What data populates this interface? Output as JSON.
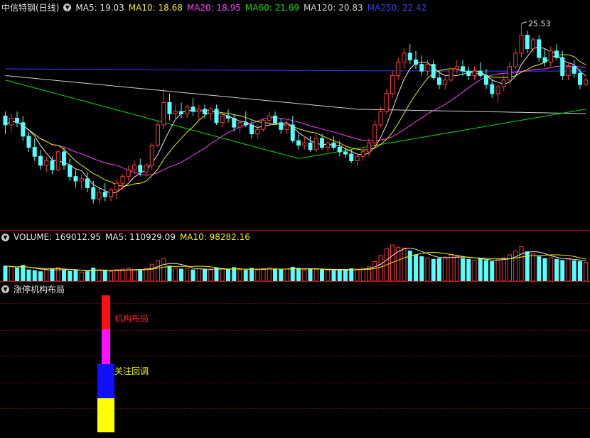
{
  "price_header": {
    "title": "中信特钢(日线)",
    "ma": [
      {
        "label": "MA5: 19.03",
        "color": "#e8e8e8"
      },
      {
        "label": "MA10: 18.68",
        "color": "#f0f000"
      },
      {
        "label": "MA20: 18.95",
        "color": "#ff40ff"
      },
      {
        "label": "MA60: 21.69",
        "color": "#00e000"
      },
      {
        "label": "MA120: 20.83",
        "color": "#d0d0d0"
      },
      {
        "label": "MA250: 22.42",
        "color": "#3c3cff"
      }
    ],
    "high_label": "25.53"
  },
  "volume_header": {
    "title": "VOLUME: 169012.95",
    "ma5": "MA5: 110929.09",
    "ma10": "MA10: 98282.16"
  },
  "indicator_header": {
    "title": "涨停机构布局"
  },
  "indicator_labels": {
    "top": "机构布局",
    "mid": "关注回调"
  },
  "icons": {
    "toggle": "chevron-down-icon"
  },
  "colors": {
    "up": "#ff3b3b",
    "down": "#54ffff",
    "ma5": "#e8e8e8",
    "ma10": "#f0f000",
    "ma20": "#ff40ff",
    "ma60": "#00e000",
    "ma120": "#d0d0d0",
    "ma250": "#3c3cff"
  },
  "chart_data": {
    "type": "candlestick",
    "ohlc": [
      [
        21.4,
        21.6,
        20.6,
        21.0
      ],
      [
        21.0,
        21.5,
        20.7,
        21.3
      ],
      [
        21.3,
        21.6,
        20.9,
        21.1
      ],
      [
        21.1,
        21.4,
        20.3,
        20.5
      ],
      [
        20.5,
        20.7,
        19.8,
        20.0
      ],
      [
        20.0,
        20.4,
        19.4,
        19.6
      ],
      [
        19.6,
        19.9,
        19.0,
        19.2
      ],
      [
        19.2,
        19.6,
        18.9,
        19.4
      ],
      [
        19.4,
        19.6,
        18.8,
        19.0
      ],
      [
        19.0,
        19.9,
        18.9,
        19.8
      ],
      [
        19.8,
        20.0,
        19.0,
        19.2
      ],
      [
        19.2,
        19.5,
        18.5,
        18.7
      ],
      [
        18.7,
        19.0,
        18.2,
        18.5
      ],
      [
        18.5,
        18.8,
        18.1,
        18.6
      ],
      [
        18.6,
        18.9,
        18.0,
        18.2
      ],
      [
        18.2,
        18.5,
        17.5,
        17.7
      ],
      [
        17.7,
        18.2,
        17.5,
        18.0
      ],
      [
        18.0,
        18.4,
        17.6,
        17.8
      ],
      [
        17.8,
        18.2,
        17.6,
        18.1
      ],
      [
        18.1,
        18.6,
        17.7,
        18.4
      ],
      [
        18.4,
        18.8,
        18.1,
        18.7
      ],
      [
        18.7,
        19.2,
        18.5,
        19.0
      ],
      [
        19.0,
        19.4,
        18.8,
        19.2
      ],
      [
        19.2,
        19.5,
        18.7,
        18.9
      ],
      [
        18.9,
        19.3,
        18.7,
        19.2
      ],
      [
        19.2,
        20.2,
        19.0,
        20.1
      ],
      [
        20.1,
        21.2,
        20.0,
        21.0
      ],
      [
        21.0,
        22.6,
        20.8,
        22.0
      ],
      [
        22.0,
        22.4,
        21.2,
        21.5
      ],
      [
        21.5,
        21.9,
        21.2,
        21.6
      ],
      [
        21.6,
        22.0,
        21.3,
        21.5
      ],
      [
        21.5,
        21.9,
        21.3,
        21.8
      ],
      [
        21.8,
        22.2,
        21.4,
        21.6
      ],
      [
        21.6,
        21.9,
        21.2,
        21.7
      ],
      [
        21.7,
        21.9,
        21.3,
        21.5
      ],
      [
        21.5,
        21.8,
        21.2,
        21.7
      ],
      [
        21.7,
        21.9,
        21.0,
        21.1
      ],
      [
        21.1,
        21.5,
        20.9,
        21.4
      ],
      [
        21.4,
        21.7,
        21.1,
        21.3
      ],
      [
        21.3,
        21.5,
        20.7,
        20.9
      ],
      [
        20.9,
        21.2,
        20.6,
        21.1
      ],
      [
        21.1,
        21.6,
        20.9,
        21.0
      ],
      [
        21.0,
        21.2,
        20.4,
        20.6
      ],
      [
        20.6,
        21.0,
        20.4,
        20.8
      ],
      [
        20.8,
        21.3,
        20.7,
        21.2
      ],
      [
        21.2,
        21.6,
        21.0,
        21.4
      ],
      [
        21.4,
        21.6,
        21.0,
        21.1
      ],
      [
        21.1,
        21.3,
        20.6,
        20.8
      ],
      [
        20.8,
        21.2,
        20.6,
        21.0
      ],
      [
        21.0,
        21.4,
        20.2,
        20.3
      ],
      [
        20.3,
        20.6,
        19.9,
        20.1
      ],
      [
        20.1,
        20.5,
        19.9,
        20.2
      ],
      [
        20.2,
        20.5,
        19.8,
        19.9
      ],
      [
        19.9,
        20.6,
        19.8,
        20.4
      ],
      [
        20.4,
        20.6,
        19.9,
        20.0
      ],
      [
        20.0,
        20.3,
        19.8,
        20.2
      ],
      [
        20.2,
        20.5,
        19.9,
        20.0
      ],
      [
        20.0,
        20.3,
        19.6,
        19.8
      ],
      [
        19.8,
        20.0,
        19.5,
        19.7
      ],
      [
        19.7,
        19.9,
        19.3,
        19.4
      ],
      [
        19.4,
        19.7,
        19.2,
        19.6
      ],
      [
        19.6,
        20.0,
        19.4,
        19.8
      ],
      [
        19.8,
        20.4,
        19.6,
        20.2
      ],
      [
        20.2,
        21.2,
        20.0,
        21.0
      ],
      [
        21.0,
        21.8,
        20.9,
        21.6
      ],
      [
        21.6,
        22.6,
        21.5,
        22.4
      ],
      [
        22.4,
        23.4,
        22.2,
        23.2
      ],
      [
        23.2,
        24.0,
        23.0,
        23.8
      ],
      [
        23.8,
        24.4,
        23.5,
        24.2
      ],
      [
        24.2,
        24.6,
        23.7,
        23.9
      ],
      [
        23.9,
        24.3,
        23.5,
        23.7
      ],
      [
        23.7,
        24.1,
        23.2,
        23.4
      ],
      [
        23.4,
        23.9,
        23.2,
        23.7
      ],
      [
        23.7,
        23.9,
        23.0,
        23.1
      ],
      [
        23.1,
        23.4,
        22.6,
        22.8
      ],
      [
        22.8,
        23.2,
        22.6,
        23.0
      ],
      [
        23.0,
        23.6,
        22.9,
        23.5
      ],
      [
        23.5,
        23.9,
        23.3,
        23.6
      ],
      [
        23.6,
        23.9,
        23.2,
        23.4
      ],
      [
        23.4,
        23.6,
        23.0,
        23.2
      ],
      [
        23.2,
        23.6,
        23.0,
        23.4
      ],
      [
        23.4,
        23.8,
        23.1,
        23.2
      ],
      [
        23.2,
        23.5,
        22.6,
        22.8
      ],
      [
        22.8,
        23.0,
        22.2,
        22.4
      ],
      [
        22.4,
        22.8,
        22.0,
        22.7
      ],
      [
        22.7,
        23.2,
        22.5,
        23.0
      ],
      [
        23.0,
        23.8,
        22.8,
        23.6
      ],
      [
        23.6,
        24.4,
        23.5,
        24.2
      ],
      [
        24.2,
        25.53,
        24.0,
        25.0
      ],
      [
        25.0,
        25.2,
        24.2,
        24.4
      ],
      [
        24.4,
        24.9,
        24.2,
        24.8
      ],
      [
        24.8,
        25.0,
        23.8,
        24.0
      ],
      [
        24.0,
        24.4,
        23.6,
        23.8
      ],
      [
        23.8,
        24.5,
        23.6,
        24.3
      ],
      [
        24.3,
        24.6,
        23.9,
        24.0
      ],
      [
        24.0,
        24.3,
        23.0,
        23.2
      ],
      [
        23.2,
        23.8,
        23.0,
        23.6
      ],
      [
        23.6,
        23.9,
        23.1,
        23.3
      ],
      [
        23.3,
        23.5,
        22.6,
        22.8
      ],
      [
        22.8,
        23.1,
        22.7,
        23.0
      ]
    ],
    "ylim": [
      16.6,
      26.0
    ],
    "volume": [
      40,
      38,
      35,
      42,
      30,
      28,
      25,
      30,
      32,
      36,
      28,
      26,
      30,
      24,
      25,
      35,
      30,
      28,
      26,
      30,
      32,
      34,
      30,
      28,
      33,
      45,
      55,
      60,
      40,
      35,
      32,
      34,
      30,
      33,
      31,
      30,
      35,
      32,
      31,
      36,
      30,
      29,
      34,
      30,
      33,
      35,
      31,
      30,
      32,
      37,
      34,
      30,
      33,
      31,
      30,
      29,
      28,
      30,
      29,
      33,
      32,
      34,
      38,
      52,
      68,
      86,
      96,
      90,
      88,
      80,
      70,
      65,
      62,
      58,
      60,
      64,
      70,
      66,
      60,
      58,
      56,
      60,
      55,
      52,
      57,
      62,
      70,
      80,
      92,
      78,
      72,
      65,
      60,
      62,
      58,
      55,
      60,
      54,
      52,
      50
    ],
    "volume_ma5_label": "MA5: 110929.09",
    "volume_ma10_label": "MA10: 98282.16",
    "indicator_signal": {
      "index": 20,
      "segments": [
        "red",
        "magenta",
        "blue",
        "yellow"
      ]
    }
  }
}
